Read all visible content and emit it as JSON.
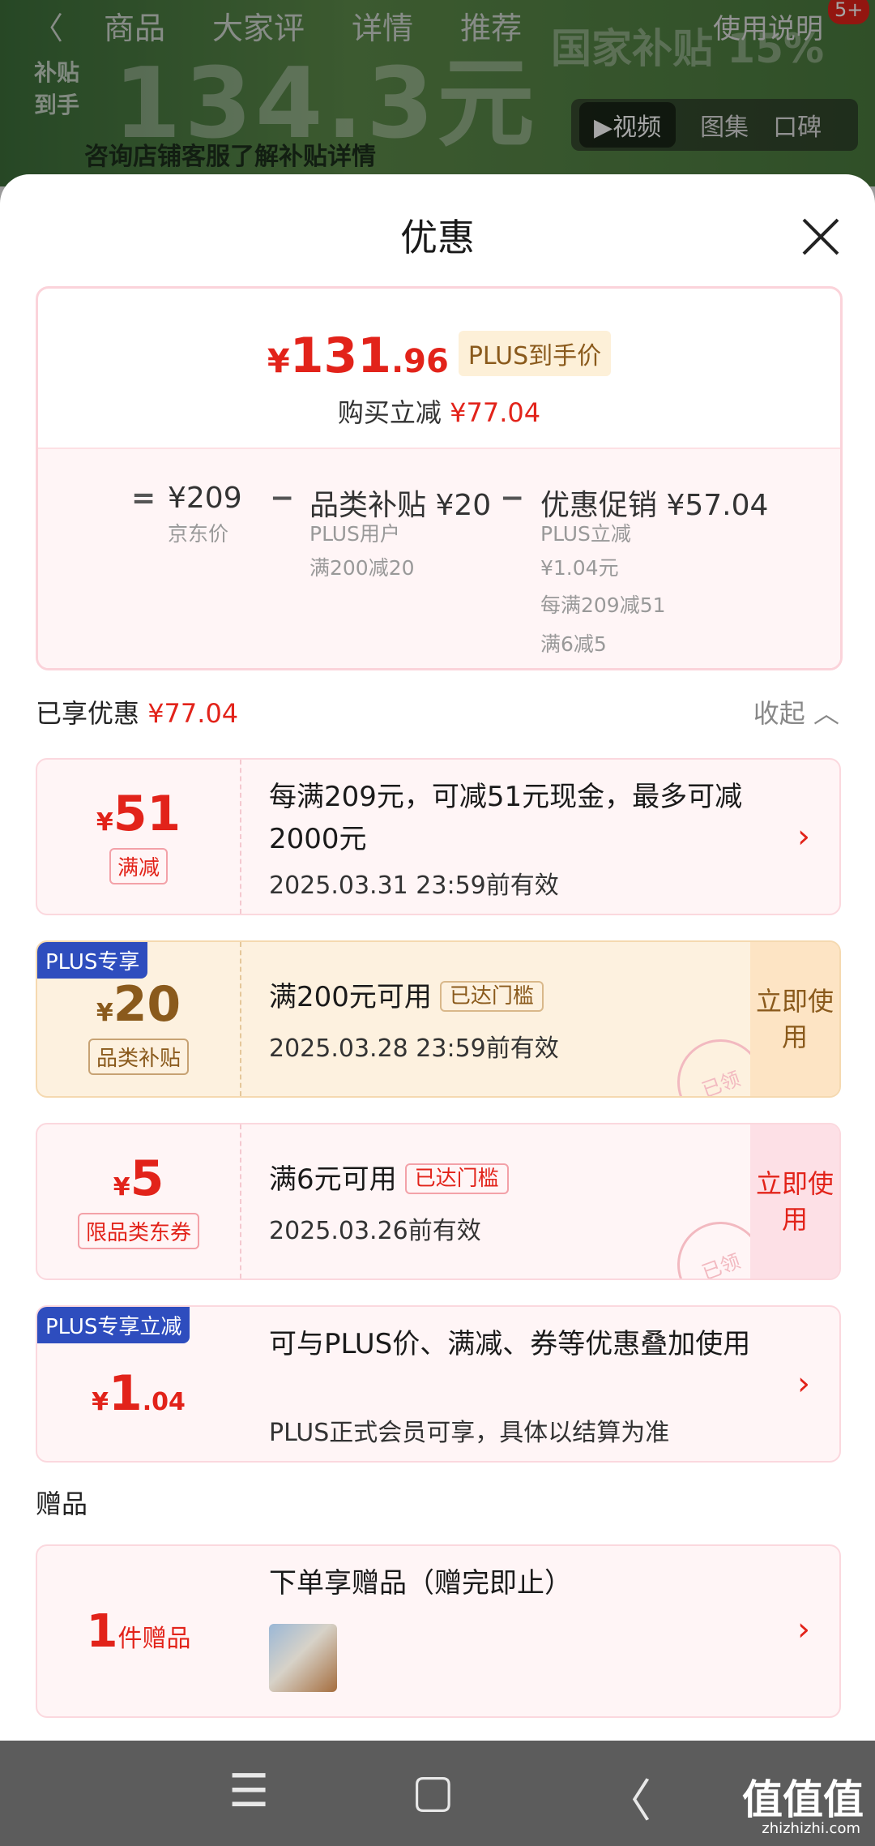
{
  "background": {
    "nav_tabs": [
      "商品",
      "大家评",
      "详情",
      "推荐"
    ],
    "nav_right": "使用说明",
    "badge": "5+",
    "subsidy_tag": "补贴到手",
    "big_price": "134.3元",
    "gov_tag": "国家补贴 15%",
    "consult_text": "咨询店铺客服了解补贴详情",
    "media_tabs": [
      "▶视频",
      "图集",
      "口碑"
    ]
  },
  "sheet": {
    "title": "优惠",
    "summary": {
      "price_yen": "¥",
      "price_int": "131",
      "price_dec": ".96",
      "plus_label": "PLUS到手价",
      "cut_label": "购买立减",
      "cut_value": "¥77.04",
      "eq": "=",
      "jd_price": "¥209",
      "jd_label": "京东价",
      "minus1": "−",
      "cat_title": "品类补贴 ¥20",
      "cat_sub1": "PLUS用户",
      "cat_sub2": "满200减20",
      "minus2": "−",
      "promo_title": "优惠促销 ¥57.04",
      "promo_sub1": "PLUS立减",
      "promo_sub2": "¥1.04元",
      "promo_sub3": "每满209减51",
      "promo_sub4": "满6减5"
    },
    "enjoyed_label": "已享优惠",
    "enjoyed_value": "¥77.04",
    "collapse": "收起",
    "coupons": [
      {
        "yen": "¥",
        "amount": "51",
        "amount_dec": "",
        "tag": "满减",
        "title": "每满209元，可减51元现金，最多可减2000元",
        "date": "2025.03.31 23:59前有效"
      },
      {
        "banner": "PLUS专享",
        "yen": "¥",
        "amount": "20",
        "amount_dec": "",
        "tag": "品类补贴",
        "title": "满200元可用",
        "threshold": "已达门槛",
        "date": "2025.03.28 23:59前有效",
        "use": "立即使用",
        "stamp": "已领"
      },
      {
        "yen": "¥",
        "amount": "5",
        "amount_dec": "",
        "tag": "限品类东券",
        "title": "满6元可用",
        "threshold": "已达门槛",
        "date": "2025.03.26前有效",
        "use": "立即使用",
        "stamp": "已领"
      },
      {
        "banner": "PLUS专享立减",
        "yen": "¥",
        "amount": "1",
        "amount_dec": ".04",
        "title": "可与PLUS价、满减、券等优惠叠加使用",
        "date": "PLUS正式会员可享，具体以结算为准"
      }
    ],
    "gift_section": "赠品",
    "gift": {
      "count": "1",
      "unit": "件赠品",
      "title": "下单享赠品（赠完即止）"
    }
  },
  "nav": {
    "menu": "☰",
    "home": "▢",
    "back": "〈"
  },
  "watermark": {
    "main": "值值值",
    "sub": "zhizhizhi.com"
  }
}
